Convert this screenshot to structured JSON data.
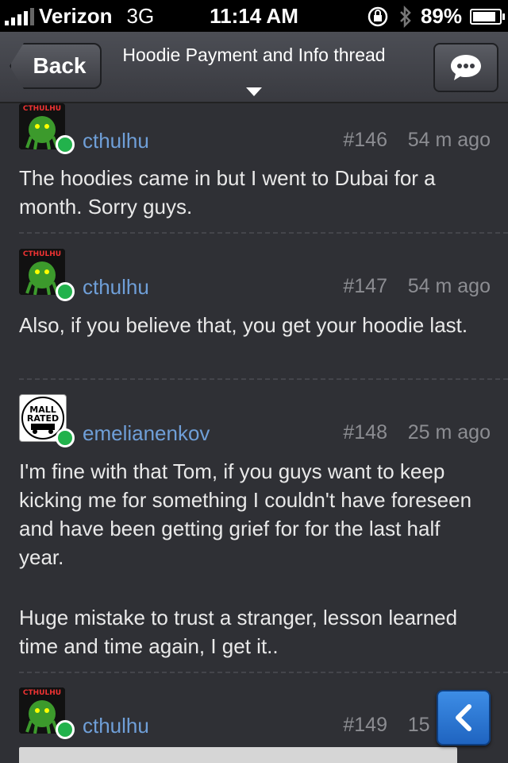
{
  "statusbar": {
    "carrier": "Verizon",
    "network": "3G",
    "time": "11:14 AM",
    "battery": "89%",
    "battery_level": 0.89,
    "signal_bars": 4
  },
  "navbar": {
    "back_label": "Back",
    "title": "Hoodie Payment and Info thread"
  },
  "posts": [
    {
      "author": "cthulhu",
      "number": "#146",
      "time": "54 m ago",
      "body": "The hoodies came in but I went to Dubai for a month. Sorry guys."
    },
    {
      "author": "cthulhu",
      "number": "#147",
      "time": "54 m ago",
      "body": "Also, if you believe that, you get your hoodie last."
    },
    {
      "author": "emelianenkov",
      "number": "#148",
      "time": "25 m ago",
      "body_p1": "I'm fine with that Tom, if you guys want to keep kicking me for something I couldn't have foreseen and have been getting grief for for the last half year.",
      "body_p2": "Huge mistake to trust a stranger, lesson learned time and time again, I get it..",
      "avatar_text_1": "MALL",
      "avatar_text_2": "RATED"
    },
    {
      "author": "cthulhu",
      "number": "#149",
      "time": "15 m ago"
    }
  ],
  "avatar_text": "CTHULHU",
  "icons": {
    "chat": "chat-bubble-icon",
    "scroll": "chevron-left-icon",
    "lock": "rotation-lock-icon",
    "bluetooth": "bluetooth-icon"
  },
  "colors": {
    "author": "#6f9fd8",
    "online": "#22b24c",
    "background": "#2f3035",
    "accent_button": "#2a78d8"
  }
}
